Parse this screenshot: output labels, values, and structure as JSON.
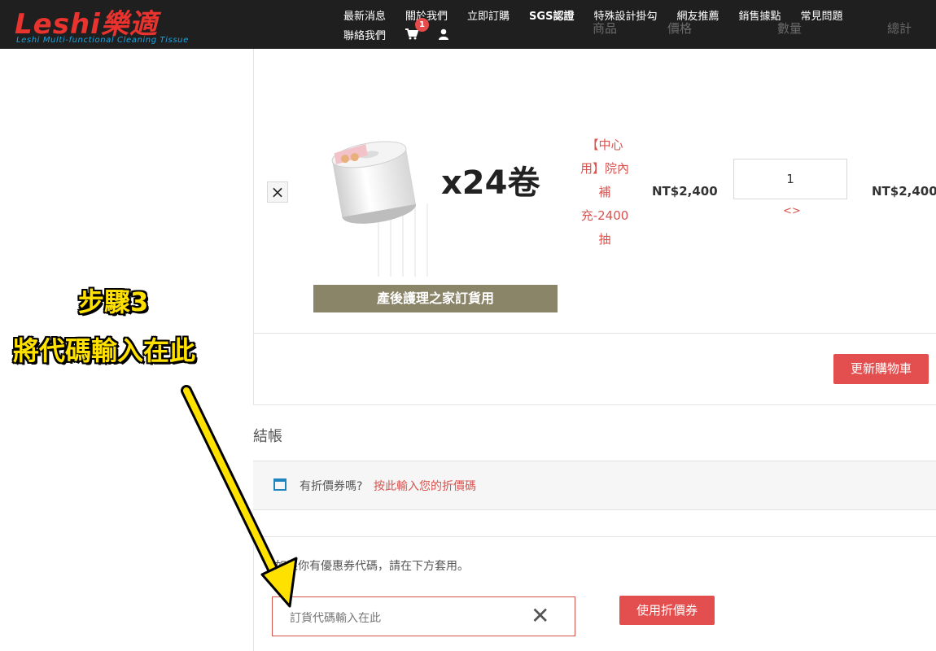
{
  "header": {
    "logo_text": "Leshi",
    "logo_cn": "樂適",
    "logo_tagline": "Leshi Multi-functional Cleaning Tissue",
    "nav": [
      "最新消息",
      "關於我們",
      "立即訂購",
      "SGS認證",
      "特殊設計掛勾",
      "網友推薦",
      "銷售據點",
      "常見問題"
    ],
    "nav_row2": [
      "聯絡我們"
    ],
    "cart_count": "1",
    "cart_icon": "cart-icon",
    "user_icon": "user-icon"
  },
  "table_header": {
    "product": "商品",
    "price": "價格",
    "quantity": "數量",
    "total": "總計"
  },
  "cart": {
    "remove_label": "×",
    "image_overlay": "x24卷",
    "image_banner": "產後護理之家訂貨用",
    "product_name": "【中心用】院內補充-2400抽",
    "price": "NT$2,400",
    "quantity": "1",
    "quantity_arrows": "<>",
    "total": "NT$2,400",
    "update_button": "更新購物車"
  },
  "checkout": {
    "title": "結帳",
    "coupon_question": "有折價券嗎?",
    "coupon_link": "按此輸入您的折價碼",
    "coupon_hint": "如果你有優惠券代碼，請在下方套用。",
    "coupon_input_value": "訂貨代碼輸入在此",
    "clear_label": "✕",
    "apply_button": "使用折價券"
  },
  "annotation": {
    "line1": "步驟3",
    "line2": "將代碼輸入在此"
  },
  "colors": {
    "header_bg": "#1f1f1f",
    "accent_red": "#e34f4f",
    "link_red": "#d9534f",
    "logo_blue": "#1aa5e0",
    "annotation_yellow": "#ffe100",
    "banner_olive": "#8a8468"
  }
}
